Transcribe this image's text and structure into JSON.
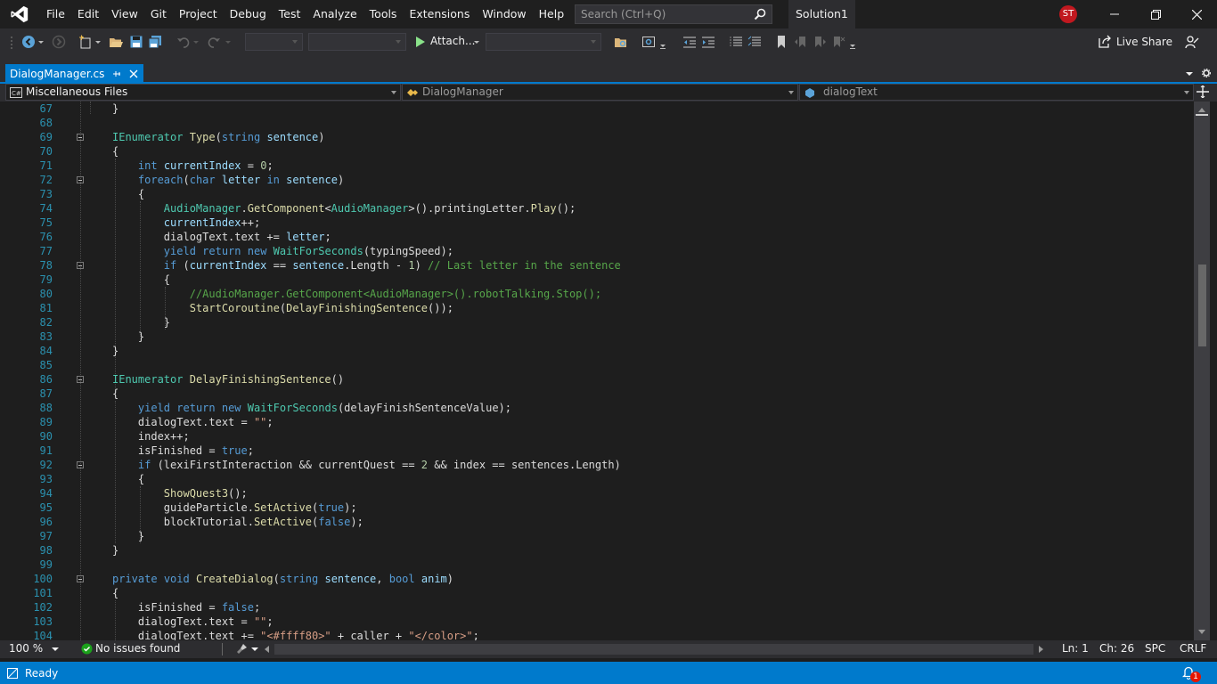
{
  "menu": [
    "File",
    "Edit",
    "View",
    "Git",
    "Project",
    "Debug",
    "Test",
    "Analyze",
    "Tools",
    "Extensions",
    "Window",
    "Help"
  ],
  "search": {
    "placeholder": "Search (Ctrl+Q)"
  },
  "solution_name": "Solution1",
  "user_initials": "ST",
  "toolbar": {
    "attach_label": "Attach...",
    "live_share_label": "Live Share"
  },
  "tab": {
    "title": "DialogManager.cs"
  },
  "nav": {
    "project": "Miscellaneous Files",
    "type": "DialogManager",
    "member": "dialogText"
  },
  "status": {
    "zoom": "100 %",
    "issues": "No issues found",
    "line": "Ln: 1",
    "col": "Ch: 26",
    "spaces": "SPC",
    "eol": "CRLF",
    "ready": "Ready",
    "notifications": "1"
  },
  "code": [
    {
      "n": "67",
      "html": "}",
      "fold": false
    },
    {
      "n": "68",
      "html": "",
      "fold": false
    },
    {
      "n": "69",
      "html": "<span class='t'>IEnumerator</span> <span class='m'>Type</span>(<span class='k'>string</span> <span class='p'>sentence</span>)",
      "fold": true
    },
    {
      "n": "70",
      "html": "{",
      "fold": false
    },
    {
      "n": "71",
      "html": "    <span class='k'>int</span> <span class='p'>currentIndex</span> = <span class='n'>0</span>;",
      "fold": false
    },
    {
      "n": "72",
      "html": "    <span class='k'>foreach</span>(<span class='k'>char</span> <span class='p'>letter</span> <span class='k'>in</span> <span class='p'>sentence</span>)",
      "fold": true
    },
    {
      "n": "73",
      "html": "    {",
      "fold": false
    },
    {
      "n": "74",
      "html": "        <span class='t'>AudioManager</span>.<span class='m'>GetComponent</span>&lt;<span class='t'>AudioManager</span>&gt;().printingLetter.<span class='m'>Play</span>();",
      "fold": false
    },
    {
      "n": "75",
      "html": "        <span class='p'>currentIndex</span>++;",
      "fold": false
    },
    {
      "n": "76",
      "html": "        dialogText.text += <span class='p'>letter</span>;",
      "fold": false
    },
    {
      "n": "77",
      "html": "        <span class='k'>yield</span> <span class='k'>return</span> <span class='k'>new</span> <span class='t'>WaitForSeconds</span>(typingSpeed);",
      "fold": false
    },
    {
      "n": "78",
      "html": "        <span class='k'>if</span> (<span class='p'>currentIndex</span> == <span class='p'>sentence</span>.Length - <span class='n'>1</span>) <span class='c'>// Last letter in the sentence</span>",
      "fold": true
    },
    {
      "n": "79",
      "html": "        {",
      "fold": false
    },
    {
      "n": "80",
      "html": "            <span class='c'>//AudioManager.GetComponent&lt;AudioManager&gt;().robotTalking.Stop();</span>",
      "fold": false
    },
    {
      "n": "81",
      "html": "            <span class='m'>StartCoroutine</span>(<span class='m'>DelayFinishingSentence</span>());",
      "fold": false
    },
    {
      "n": "82",
      "html": "        }",
      "fold": false
    },
    {
      "n": "83",
      "html": "    }",
      "fold": false
    },
    {
      "n": "84",
      "html": "}",
      "fold": false
    },
    {
      "n": "85",
      "html": "",
      "fold": false
    },
    {
      "n": "86",
      "html": "<span class='t'>IEnumerator</span> <span class='m'>DelayFinishingSentence</span>()",
      "fold": true
    },
    {
      "n": "87",
      "html": "{",
      "fold": false
    },
    {
      "n": "88",
      "html": "    <span class='k'>yield</span> <span class='k'>return</span> <span class='k'>new</span> <span class='t'>WaitForSeconds</span>(delayFinishSentenceValue);",
      "fold": false
    },
    {
      "n": "89",
      "html": "    dialogText.text = <span class='s'>\"\"</span>;",
      "fold": false
    },
    {
      "n": "90",
      "html": "    index++;",
      "fold": false
    },
    {
      "n": "91",
      "html": "    isFinished = <span class='k'>true</span>;",
      "fold": false
    },
    {
      "n": "92",
      "html": "    <span class='k'>if</span> (lexiFirstInteraction &amp;&amp; currentQuest == <span class='n'>2</span> &amp;&amp; index == sentences.Length)",
      "fold": true
    },
    {
      "n": "93",
      "html": "    {",
      "fold": false
    },
    {
      "n": "94",
      "html": "        <span class='m'>ShowQuest3</span>();",
      "fold": false
    },
    {
      "n": "95",
      "html": "        guideParticle.<span class='m'>SetActive</span>(<span class='k'>true</span>);",
      "fold": false
    },
    {
      "n": "96",
      "html": "        blockTutorial.<span class='m'>SetActive</span>(<span class='k'>false</span>);",
      "fold": false
    },
    {
      "n": "97",
      "html": "    }",
      "fold": false
    },
    {
      "n": "98",
      "html": "}",
      "fold": false
    },
    {
      "n": "99",
      "html": "",
      "fold": false
    },
    {
      "n": "100",
      "html": "<span class='k'>private</span> <span class='k'>void</span> <span class='m'>CreateDialog</span>(<span class='k'>string</span> <span class='p'>sentence</span>, <span class='k'>bool</span> <span class='p'>anim</span>)",
      "fold": true
    },
    {
      "n": "101",
      "html": "{",
      "fold": false
    },
    {
      "n": "102",
      "html": "    isFinished = <span class='k'>false</span>;",
      "fold": false
    },
    {
      "n": "103",
      "html": "    dialogText.text = <span class='s'>\"\"</span>;",
      "fold": false
    },
    {
      "n": "104",
      "html": "    dialogText.text += <span class='s'>\"&lt;#ffff80&gt;\"</span> + caller + <span class='s'>\"&lt;/color&gt;\"</span>;",
      "fold": false
    }
  ]
}
